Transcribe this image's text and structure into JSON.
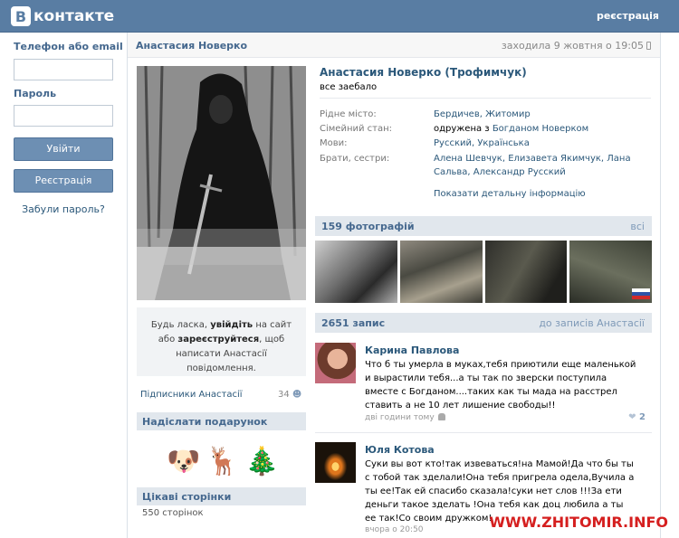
{
  "header": {
    "logo_mark": "В",
    "logo_text": "контакте",
    "register_link": "реєстрація"
  },
  "login": {
    "phone_label": "Телефон або email",
    "password_label": "Пароль",
    "login_button": "Увійти",
    "register_button": "Реєстрація",
    "forgot_link": "Забули пароль?"
  },
  "profile_bar": {
    "name": "Анастасия Новерко",
    "last_seen": "заходила 9 жовтня о 19:05"
  },
  "profile": {
    "full_name": "Анастасия Новерко (Трофимчук)",
    "status": "все заебало",
    "info": [
      {
        "key": "Рідне місто:",
        "value": "Бердичев, Житомир"
      },
      {
        "key": "Сімейний стан:",
        "value_plain": "одружена з",
        "value": "Богданом Новерком"
      },
      {
        "key": "Мови:",
        "value": "Русский, Українська"
      },
      {
        "key": "Брати, сестри:",
        "value": "Алена Шевчук, Елизавета Якимчук, Лана Сальва, Александр Русский"
      }
    ],
    "more_info_link": "Показати детальну інформацію"
  },
  "message_box": {
    "part1": "Будь ласка,",
    "login_word": "увійдіть",
    "part2": "на сайт або",
    "register_word": "зареєструйтеся",
    "part3": ", щоб написати Анастасії повідомлення."
  },
  "subscribers": {
    "label": "Підписники Анастасії",
    "count": "34"
  },
  "gifts": {
    "title": "Надіслати подарунок",
    "items": [
      "🐶",
      "🦌",
      "🎄"
    ]
  },
  "pages": {
    "title": "Цікаві сторінки",
    "count": "550 сторінок"
  },
  "photos": {
    "title": "159 фотографій",
    "all_link": "всі"
  },
  "wall": {
    "title": "2651 запис",
    "to_posts_link": "до записів Анастасії",
    "posts": [
      {
        "author": "Карина Павлова",
        "text": "Что б ты умерла в муках,тебя приютили еще маленькой и вырастили тебя...а ты так по зверски поступила вместе с Богданом....таких как ты мада на расстрел ставить а не 10 лет лишение свободы!!",
        "meta": "дві години тому",
        "likes": "2"
      },
      {
        "author": "Юля Котова",
        "text": "Суки вы вот кто!так извеваться!на Мамой!Да что бы ты с тобой так зделали!Она тебя пригрела одела,Вучила а ты ее!Так ей спасибо сказала!суки нет слов !!!За ети деньги такое зделать !Она тебя как доц любила а ты ее так!Со своим дружком!",
        "meta": "вчора о 20:50",
        "likes": ""
      }
    ]
  },
  "watermark": "WWW.ZHITOMIR.INFO",
  "colors": {
    "header_bg": "#597da3",
    "link": "#2b587a",
    "section_bg": "#e1e7ed",
    "watermark": "#d51f1f"
  }
}
